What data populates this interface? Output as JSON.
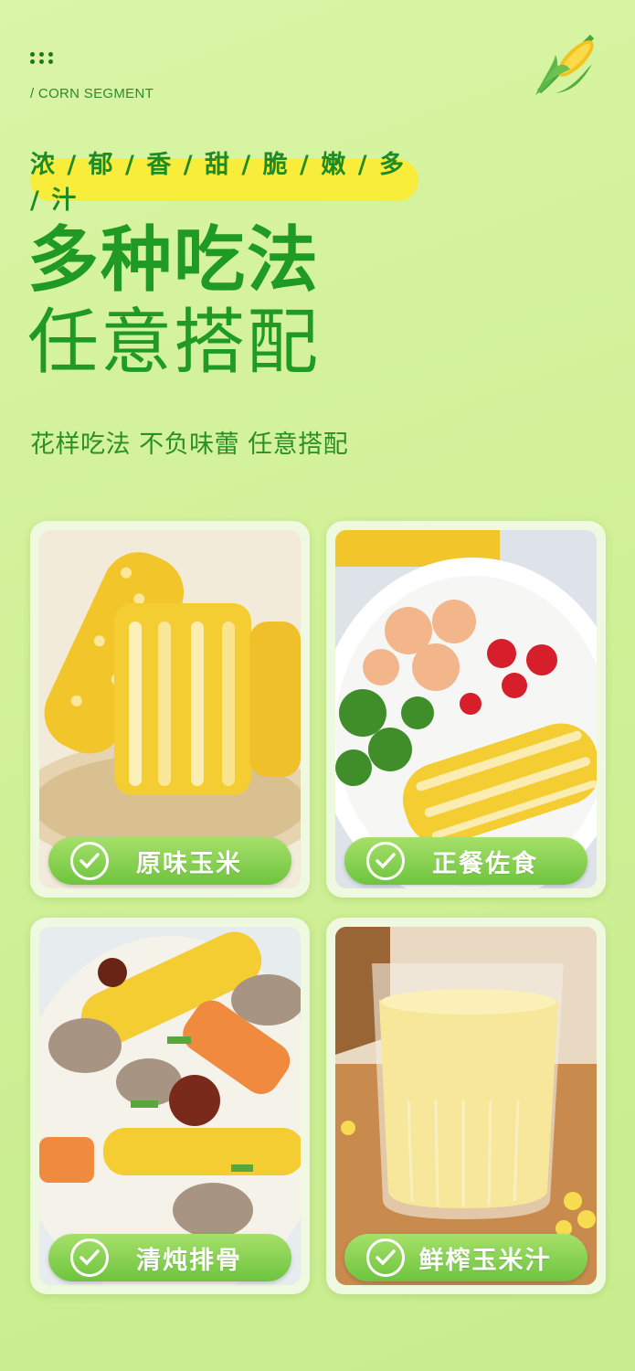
{
  "header": {
    "section_label": "/ CORN SEGMENT",
    "tag_banner": "浓 / 郁 / 香 / 甜 / 脆 / 嫩 / 多 / 汁",
    "title_line1": "多种吃法",
    "title_line2": "任意搭配",
    "subtitle": "花样吃法 不负味蕾 任意搭配"
  },
  "cards": [
    {
      "label": "原味玉米",
      "icon": "check-icon"
    },
    {
      "label": "正餐佐食",
      "icon": "check-icon"
    },
    {
      "label": "清炖排骨",
      "icon": "check-icon"
    },
    {
      "label": "鲜榨玉米汁",
      "icon": "check-icon"
    }
  ],
  "colors": {
    "background": "#d2f199",
    "accent_green": "#1f9a23",
    "banner_yellow": "#f7ed3a",
    "label_green": "#6ec43e"
  }
}
